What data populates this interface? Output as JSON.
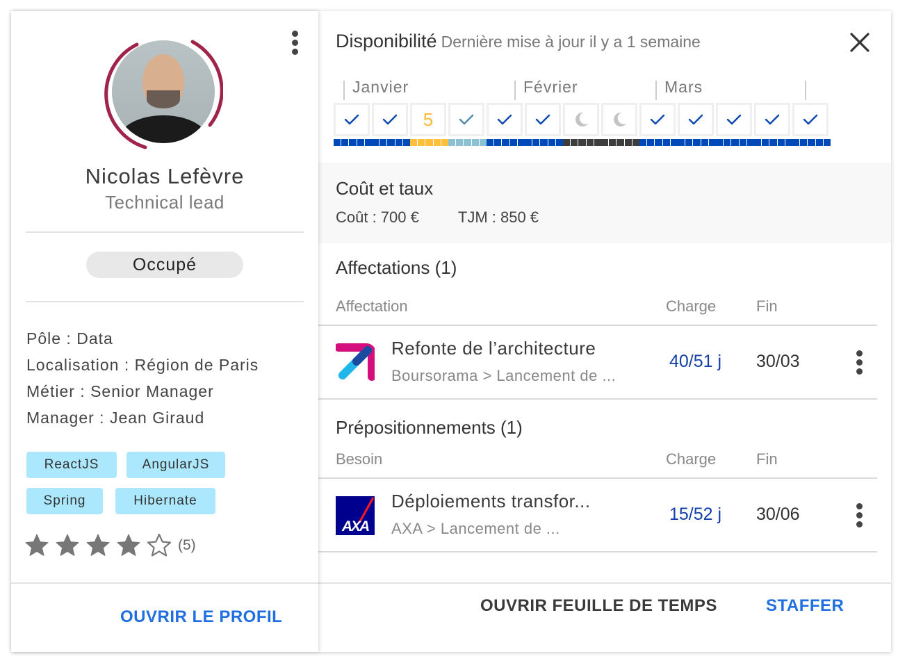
{
  "profile": {
    "name": "Nicolas Lefèvre",
    "role": "Technical lead",
    "status": "Occupé",
    "info": [
      "Pôle : Data",
      "Localisation : Région de Paris",
      "Métier : Senior Manager",
      "Manager : Jean Giraud"
    ],
    "skills": [
      "ReactJS",
      "AngularJS",
      "Spring",
      "Hibernate"
    ],
    "rating": {
      "value": 4,
      "max": 5,
      "count_label": "(5)"
    },
    "open_profile_label": "OUVRIR LE PROFIL",
    "ring_color": "#a0244a"
  },
  "availability": {
    "title": "Disponibilité",
    "subtitle": "Dernière mise à jour il y a 1 semaine",
    "months": [
      "Janvier",
      "Février",
      "Mars"
    ],
    "weeks": [
      {
        "type": "check",
        "color": "#0b49b0",
        "bar": "#0049b8"
      },
      {
        "type": "check",
        "color": "#0b49b0",
        "bar": "#0049b8"
      },
      {
        "type": "number",
        "value": "5",
        "color": "#fbb93a",
        "bar": "#ffbe3c"
      },
      {
        "type": "check",
        "color": "#4f8aa6",
        "bar": "#8cc1d3"
      },
      {
        "type": "check",
        "color": "#0b49b0",
        "bar": "#0049b8"
      },
      {
        "type": "check",
        "color": "#0b49b0",
        "bar": "#0049b8"
      },
      {
        "type": "moon",
        "color": "#c4c4c4",
        "bar": "#3d3d3d"
      },
      {
        "type": "moon",
        "color": "#c4c4c4",
        "bar": "#3d3d3d"
      },
      {
        "type": "check",
        "color": "#0b49b0",
        "bar": "#0049b8"
      },
      {
        "type": "check",
        "color": "#0b49b0",
        "bar": "#0049b8"
      },
      {
        "type": "check",
        "color": "#0b49b0",
        "bar": "#0049b8"
      },
      {
        "type": "check",
        "color": "#0b49b0",
        "bar": "#0049b8"
      },
      {
        "type": "check",
        "color": "#0b49b0",
        "bar": "#0049b8"
      }
    ]
  },
  "cost": {
    "title": "Coût et taux",
    "cost_label": "Coût : 700 €",
    "tjm_label": "TJM : 850 €"
  },
  "assignments": {
    "title": "Affectations (1)",
    "columns": [
      "Affectation",
      "Charge",
      "Fin"
    ],
    "rows": [
      {
        "title": "Refonte de l’architecture",
        "subtitle": "Boursorama > Lancement de ...",
        "charge": "40/51 j",
        "end": "30/03",
        "logo": "boursorama-logo"
      }
    ]
  },
  "prepositions": {
    "title": "Prépositionnements (1)",
    "columns": [
      "Besoin",
      "Charge",
      "Fin"
    ],
    "rows": [
      {
        "title": "Déploiements transfor...",
        "subtitle": "AXA > Lancement de ...",
        "charge": "15/52 j",
        "end": "30/06",
        "logo": "axa-logo"
      }
    ]
  },
  "actions": {
    "timesheet_label": "OUVRIR FEUILLE DE TEMPS",
    "staff_label": "STAFFER"
  }
}
